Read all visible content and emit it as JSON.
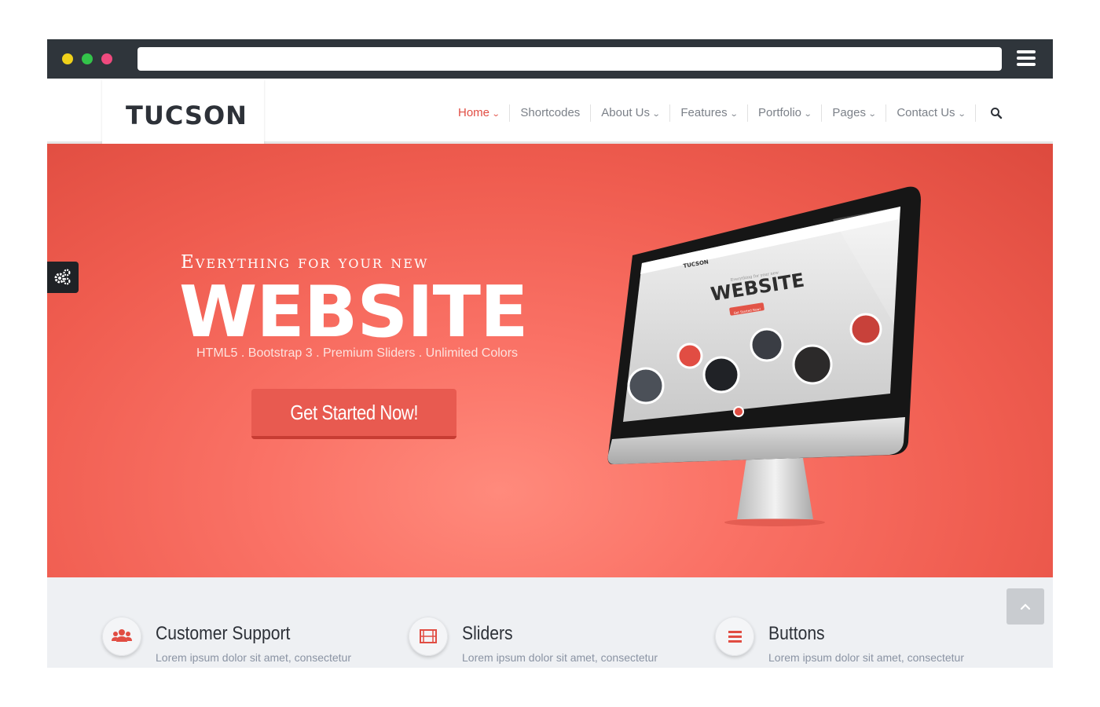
{
  "browser": {
    "dot_colors": [
      "#f0d11a",
      "#33c44a",
      "#ef4a7e"
    ],
    "url": "",
    "menu_icon": "hamburger-icon"
  },
  "site": {
    "logo": "TUCSON",
    "nav": [
      {
        "label": "Home",
        "active": true,
        "dropdown": true
      },
      {
        "label": "Shortcodes",
        "active": false,
        "dropdown": false
      },
      {
        "label": "About Us",
        "active": false,
        "dropdown": true
      },
      {
        "label": "Features",
        "active": false,
        "dropdown": true
      },
      {
        "label": "Portfolio",
        "active": false,
        "dropdown": true
      },
      {
        "label": "Pages",
        "active": false,
        "dropdown": true
      },
      {
        "label": "Contact Us",
        "active": false,
        "dropdown": true
      }
    ],
    "search_icon": "search-icon",
    "accent_color": "#e14d43"
  },
  "hero": {
    "kicker": "Everything for your new",
    "title": "WEBSITE",
    "subtitle": "HTML5 . Bootstrap 3 . Premium Sliders . Unlimited Colors",
    "cta": "Get Started Now!",
    "settings_icon": "gears-icon",
    "screen": {
      "logo": "TUCSON",
      "kicker": "Everything for your new",
      "title": "WEBSITE",
      "cta": "Get Started Now!"
    }
  },
  "features": [
    {
      "icon": "users-icon",
      "title": "Customer Support",
      "text": "Lorem ipsum dolor sit amet, consectetur"
    },
    {
      "icon": "film-icon",
      "title": "Sliders",
      "text": "Lorem ipsum dolor sit amet, consectetur"
    },
    {
      "icon": "bars-icon",
      "title": "Buttons",
      "text": "Lorem ipsum dolor sit amet, consectetur"
    }
  ],
  "back_to_top_icon": "chevron-up-icon"
}
